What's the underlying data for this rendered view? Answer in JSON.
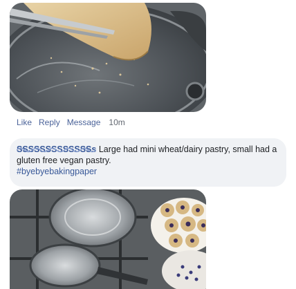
{
  "comment_actions": {
    "like": "Like",
    "reply": "Reply",
    "message": "Message",
    "time": "10m"
  },
  "comment": {
    "author": "SSSSSSSSSSSSSs",
    "text": " Large had mini wheat/dairy pastry, small had a gluten free vegan pastry.",
    "hashtag": "#byebyebakingpaper"
  }
}
